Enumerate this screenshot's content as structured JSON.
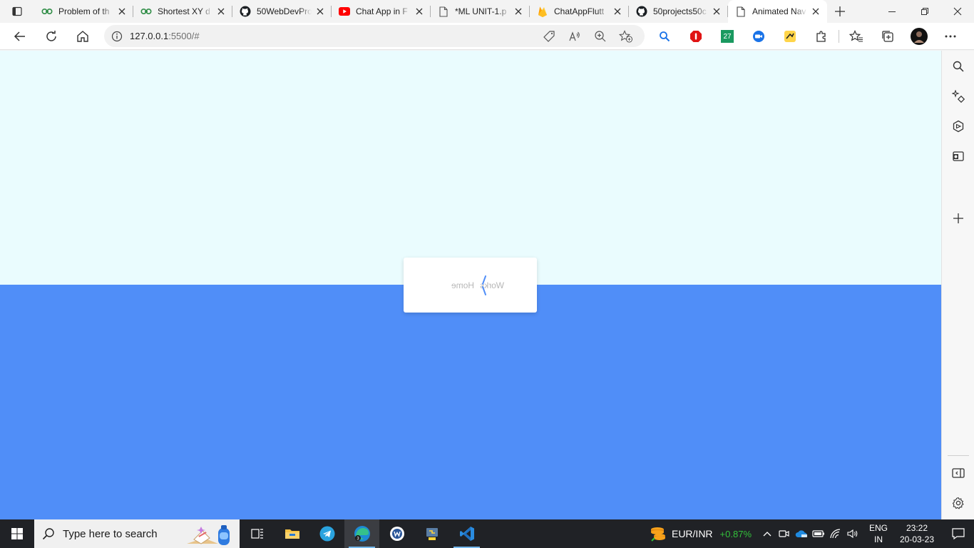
{
  "browser": {
    "tabs": [
      {
        "title": "Problem of th",
        "icon": "geeksforgeeks-icon"
      },
      {
        "title": "Shortest XY d",
        "icon": "geeksforgeeks-icon"
      },
      {
        "title": "50WebDevPro",
        "icon": "github-icon"
      },
      {
        "title": "Chat App in F",
        "icon": "youtube-icon"
      },
      {
        "title": "*ML UNIT-1.p",
        "icon": "document-icon"
      },
      {
        "title": "ChatAppFlutt",
        "icon": "firebase-icon"
      },
      {
        "title": "50projects50c",
        "icon": "github-icon"
      },
      {
        "title": "Animated Nav",
        "icon": "document-icon",
        "active": true
      }
    ],
    "address": {
      "host": "127.0.0.1",
      "rest": ":5500/#"
    },
    "extension_badge": "27"
  },
  "page": {
    "nav_items": [
      "Home",
      "Works"
    ],
    "colors": {
      "top": "#eafcfe",
      "bottom": "#508ef8",
      "card": "#ffffff",
      "toggle": "#508ef8"
    }
  },
  "taskbar": {
    "search_placeholder": "Type here to search",
    "widget": {
      "label": "EUR/INR",
      "change": "+0.87%"
    },
    "lang": {
      "line1": "ENG",
      "line2": "IN"
    },
    "clock": {
      "time": "23:22",
      "date": "20-03-23"
    }
  }
}
